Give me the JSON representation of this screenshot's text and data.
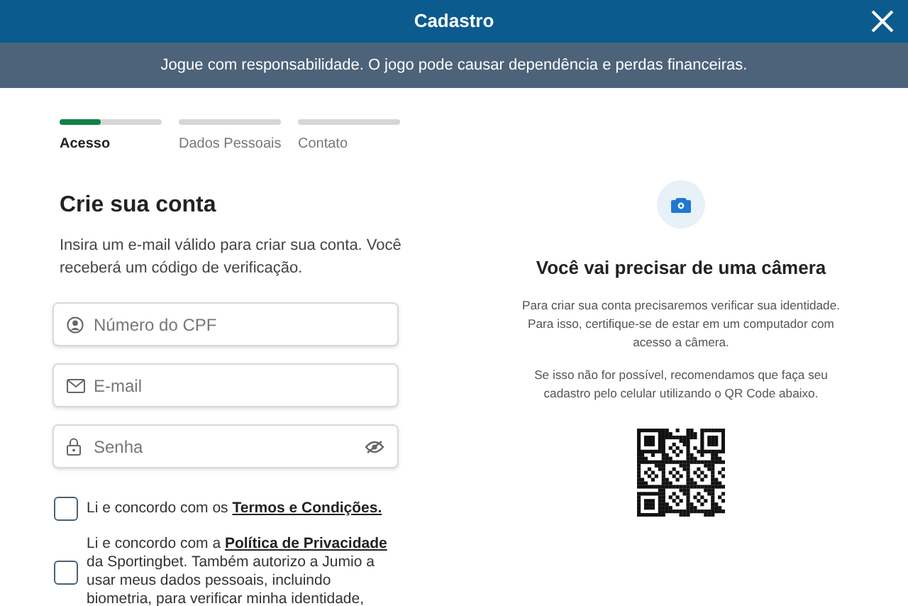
{
  "header": {
    "title": "Cadastro"
  },
  "banner": "Jogue com responsabilidade. O jogo pode causar dependência e perdas financeiras.",
  "steps": [
    {
      "label": "Acesso",
      "selected": true,
      "level": 0.4
    },
    {
      "label": "Dados Pessoais",
      "selected": false,
      "level": 0
    },
    {
      "label": "Contato",
      "selected": false,
      "level": 0
    }
  ],
  "form": {
    "title": "Crie sua conta",
    "description": "Insira um e-mail válido para criar sua conta. Você receberá um código de verificação.",
    "fields": [
      {
        "kind": "cpf",
        "placeholder": "Número do CPF"
      },
      {
        "kind": "email",
        "placeholder": "E-mail"
      },
      {
        "kind": "password",
        "placeholder": "Senha"
      }
    ],
    "agreements": [
      {
        "text_before": "Li e concordo com os ",
        "link": "Termos e Condições.",
        "checked": false
      },
      {
        "text_before": "Li e concordo com a ",
        "link": "Política de Privacidade",
        "text_after": " da Sportingbet. Também autorizo a Jumio a usar meus dados pessoais, incluindo biometria, para verificar minha identidade,",
        "checked": false
      }
    ]
  },
  "camera_panel": {
    "title": "Você vai precisar de uma câmera",
    "paragraphs": [
      "Para criar sua conta precisaremos verificar sua identidade. Para isso, certifique-se de estar em um computador com acesso a câmera.",
      "Se isso não for possível, recomendamos que faça seu cadastro pelo celular utilizando o QR Code abaixo."
    ]
  }
}
